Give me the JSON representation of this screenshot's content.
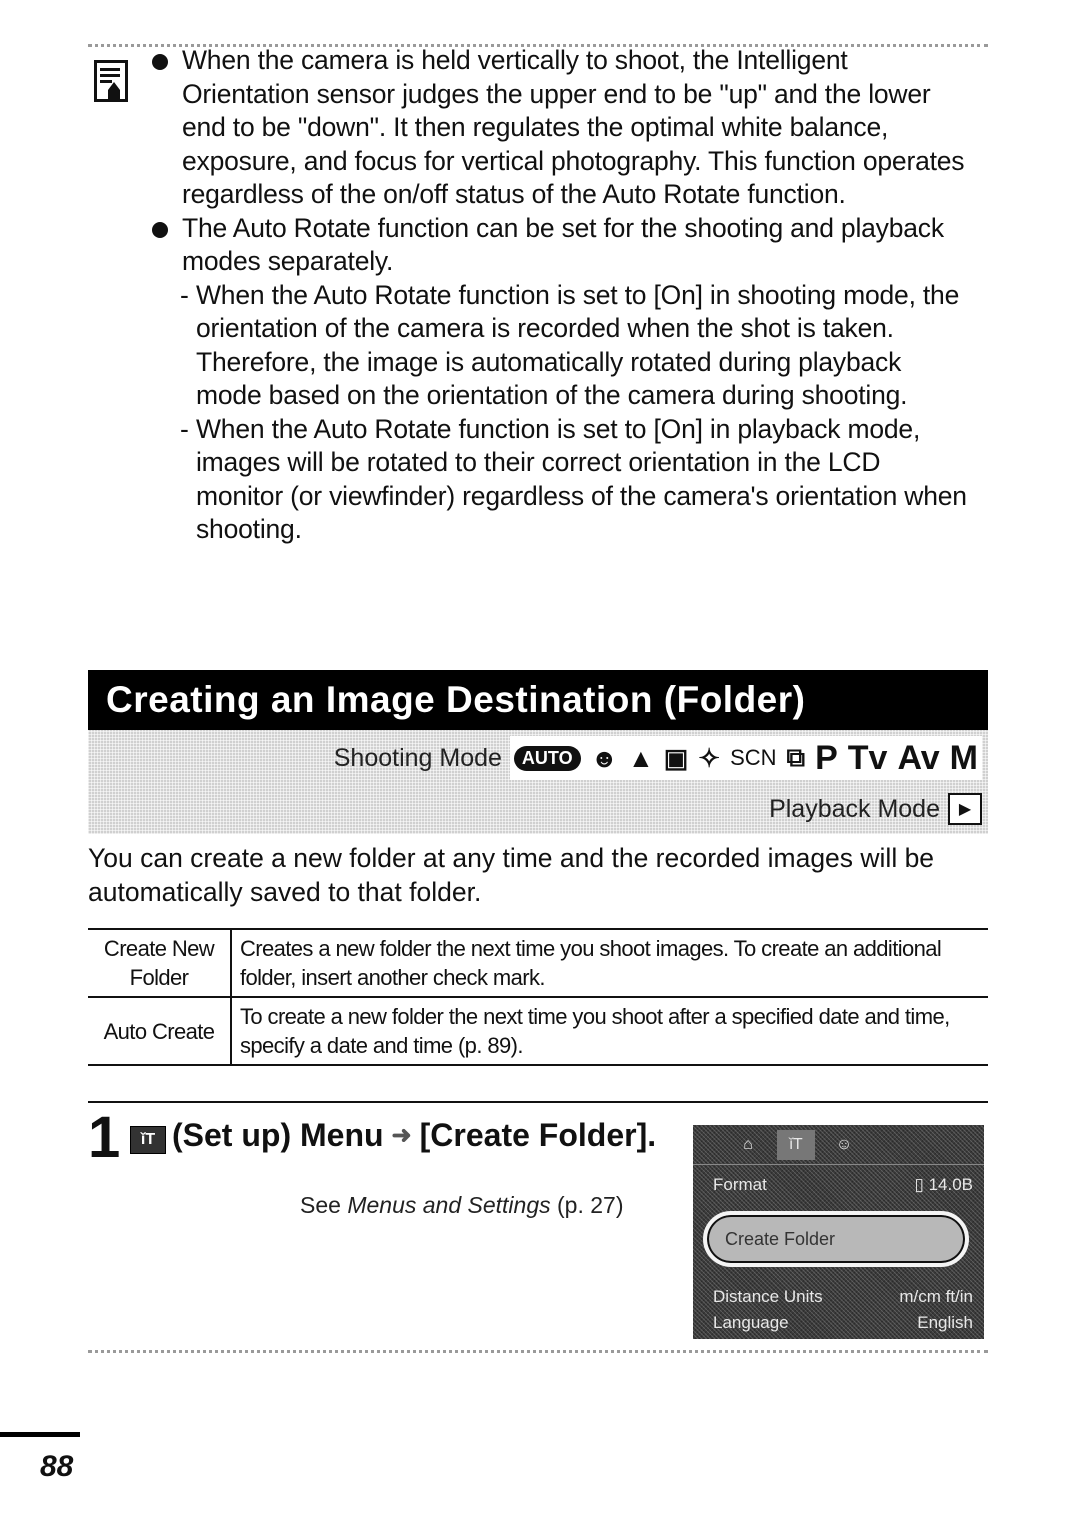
{
  "notes": {
    "icon": "memo-pencil-icon",
    "bullets": [
      {
        "text": "When the camera is held vertically to shoot, the Intelligent Orientation sensor judges the upper end to be \"up\" and the lower end to be \"down\". It then regulates the optimal white balance, exposure, and focus for vertical photography. This function operates regardless of the on/off status of the Auto Rotate function."
      },
      {
        "text": "The Auto Rotate function can be set for the shooting and playback modes separately.",
        "subs": [
          "When the Auto Rotate function is set to [On] in shooting mode, the orientation of the camera is recorded when the shot is taken. Therefore, the image is automatically rotated during playback mode based on the orientation of the camera during shooting.",
          "When the Auto Rotate function is set to [On] in playback mode, images will be rotated to their correct orientation in the LCD monitor (or viewfinder) regardless of the camera's orientation when shooting."
        ]
      }
    ]
  },
  "section": {
    "title": "Creating an Image Destination (Folder)",
    "shooting_mode_label": "Shooting Mode",
    "shooting_mode_icons": [
      {
        "name": "auto-mode-icon",
        "glyph": "AUTO"
      },
      {
        "name": "portrait-mode-icon",
        "glyph": "☻"
      },
      {
        "name": "landscape-mode-icon",
        "glyph": "▲"
      },
      {
        "name": "night-scene-mode-icon",
        "glyph": "▣"
      },
      {
        "name": "sports-mode-icon",
        "glyph": "✧"
      },
      {
        "name": "scene-mode-icon",
        "glyph": "SCN"
      },
      {
        "name": "stitch-assist-icon",
        "glyph": "⧉"
      },
      {
        "name": "program-mode-icon",
        "glyph": "P"
      },
      {
        "name": "shutter-priority-icon",
        "glyph": "Tv"
      },
      {
        "name": "aperture-priority-icon",
        "glyph": "Av"
      },
      {
        "name": "manual-mode-icon",
        "glyph": "M"
      }
    ],
    "playback_mode_label": "Playback Mode",
    "playback_icon": "▶",
    "intro": "You can create a new folder at any time and the recorded images will be automatically saved to that folder."
  },
  "table": {
    "rows": [
      {
        "term": "Create New Folder",
        "desc": "Creates a new folder the next time you shoot images. To create an additional folder, insert another check mark."
      },
      {
        "term": "Auto Create",
        "desc": "To create a new folder the next time you shoot after a specified date and time, specify a date and time (p. 89)."
      }
    ]
  },
  "step": {
    "number": "1",
    "icon_glyph": "ǐT",
    "title_part1": "(Set up) Menu",
    "arrow": "➜",
    "title_part2": "[Create Folder].",
    "note_prefix": "See ",
    "note_link": "Menus and Settings",
    "note_suffix": " (p. 27)"
  },
  "lcd": {
    "tabs": [
      "⌂",
      "ǐT",
      "☺"
    ],
    "rows": [
      {
        "label": "Format",
        "value": "▯ 14.0B"
      },
      {
        "label": "Create Folder",
        "value": ""
      },
      {
        "label": "Distance Units",
        "value": "m/cm  ft/in"
      },
      {
        "label": "Language",
        "value": "English"
      }
    ]
  },
  "footer": {
    "page_number": "88"
  }
}
